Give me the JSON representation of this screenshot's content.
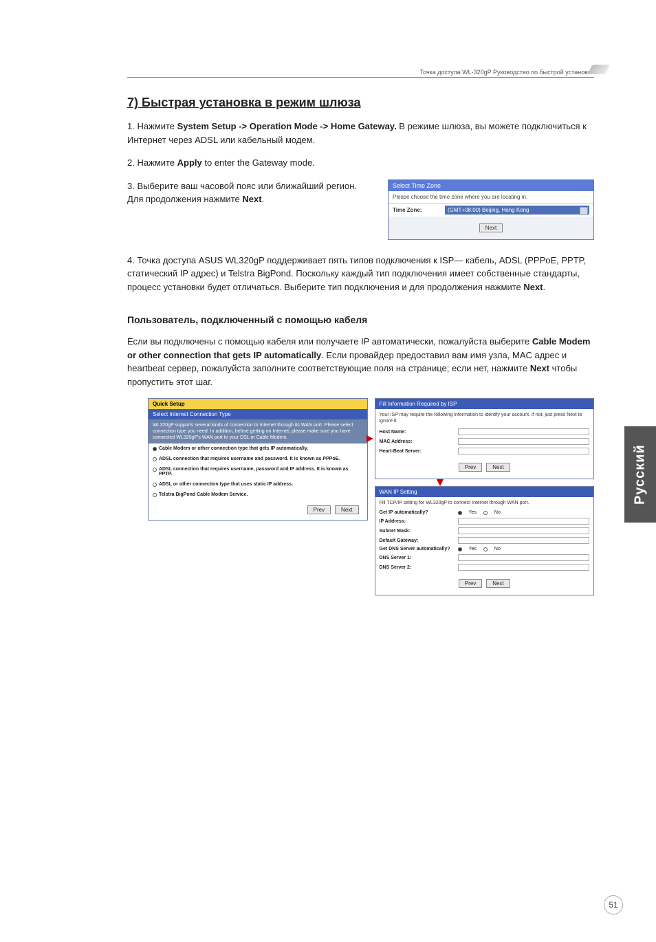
{
  "header": {
    "breadcrumb": "Точка доступа WL-320gP Руководство по быстрой установке"
  },
  "title": "7) Быстрая установка в режим шлюза",
  "steps": {
    "s1_pre": "1. Нажмите ",
    "s1_bold": "System Setup -> Operation Mode -> Home Gateway.",
    "s1_post": " В режиме шлюза, вы можете подключиться  к Интернет через ADSL или кабельный модем.",
    "s2_pre": "2. Нажмите ",
    "s2_bold": "Apply",
    "s2_post": " to enter the Gateway mode.",
    "s3_pre": "3. Выберите ваш часовой пояс или ближайший регион. Для продолжения нажмите ",
    "s3_bold": "Next",
    "s3_post": ".",
    "s4_pre": "4. Точка доступа ASUS WL320gP поддерживает пять типов подключения к ISP— кабель, ADSL (PPPoE, PPTP, статический IP адрес) и Telstra BigPond. Поскольку каждый тип подключения имеет собственные стандарты, процесс установки будет отличаться. Выберите тип подключения и для продолжения нажмите ",
    "s4_bold": "Next",
    "s4_post": "."
  },
  "timezone_panel": {
    "title": "Select Time Zone",
    "sub": "Please choose the time zone where you are locating in.",
    "label": "Time Zone:",
    "value": "(GMT+08:00) Beijing, Hong Kong",
    "btn_next": "Next"
  },
  "cable_section": {
    "heading": "Пользователь, подключенный с помощью кабеля",
    "p_pre": "Если вы подключены с помощью кабеля или получаете IP автоматически, пожалуйста выберите ",
    "p_bold1": "Cable Modem or other connection that gets IP automatically",
    "p_mid": ". Если провайдер предоставил вам имя узла, MAC адрес и heartbeat сервер, пожалуйста заполните соответствующие поля на странице; если нет, нажмите ",
    "p_bold2": "Next",
    "p_post": " чтобы пропустить этот шаг."
  },
  "quick_setup": {
    "bar1": "Quick Setup",
    "bar2": "Select Internet Connection Type",
    "desc": "WL320gP supports several kinds of connection to Internet through its WAN port. Please select connection type you need. In addition, before getting on Internet, please make sure you have connected WL320gP's WAN port to your DSL or Cable Modem.",
    "opts": [
      "Cable Modem or other connection type that gets IP automatically.",
      "ADSL connection that requires username and password. It is known as PPPoE.",
      "ADSL connection that requires username, password and IP address. It is known as PPTP.",
      "ADSL or other connection type that uses static IP address.",
      "Telstra BigPond Cable Modem Service."
    ],
    "btn_prev": "Prev",
    "btn_next": "Next"
  },
  "isp_panel": {
    "title": "Fill Information Required by ISP",
    "note": "Your ISP may require the following information to identify your account. If not, just press Next to ignore it.",
    "rows": {
      "host": "Host Name:",
      "mac": "MAC Address:",
      "hb": "Heart-Beat Server:"
    },
    "btn_prev": "Prev",
    "btn_next": "Next"
  },
  "wan_panel": {
    "title": "WAN IP Setting",
    "note": "Fill TCP/IP setting for WL320gP to connect Internet through WAN port.",
    "rows": {
      "getip": "Get IP automatically?",
      "ip": "IP Address:",
      "mask": "Subnet Mask:",
      "gw": "Default Gateway:",
      "getdns": "Get DNS Server automatically?",
      "dns1": "DNS Server 1:",
      "dns2": "DNS Server 2:"
    },
    "yes": "Yes",
    "no": "No",
    "btn_prev": "Prev",
    "btn_next": "Next"
  },
  "side_tab": "Русский",
  "page_number": "51"
}
